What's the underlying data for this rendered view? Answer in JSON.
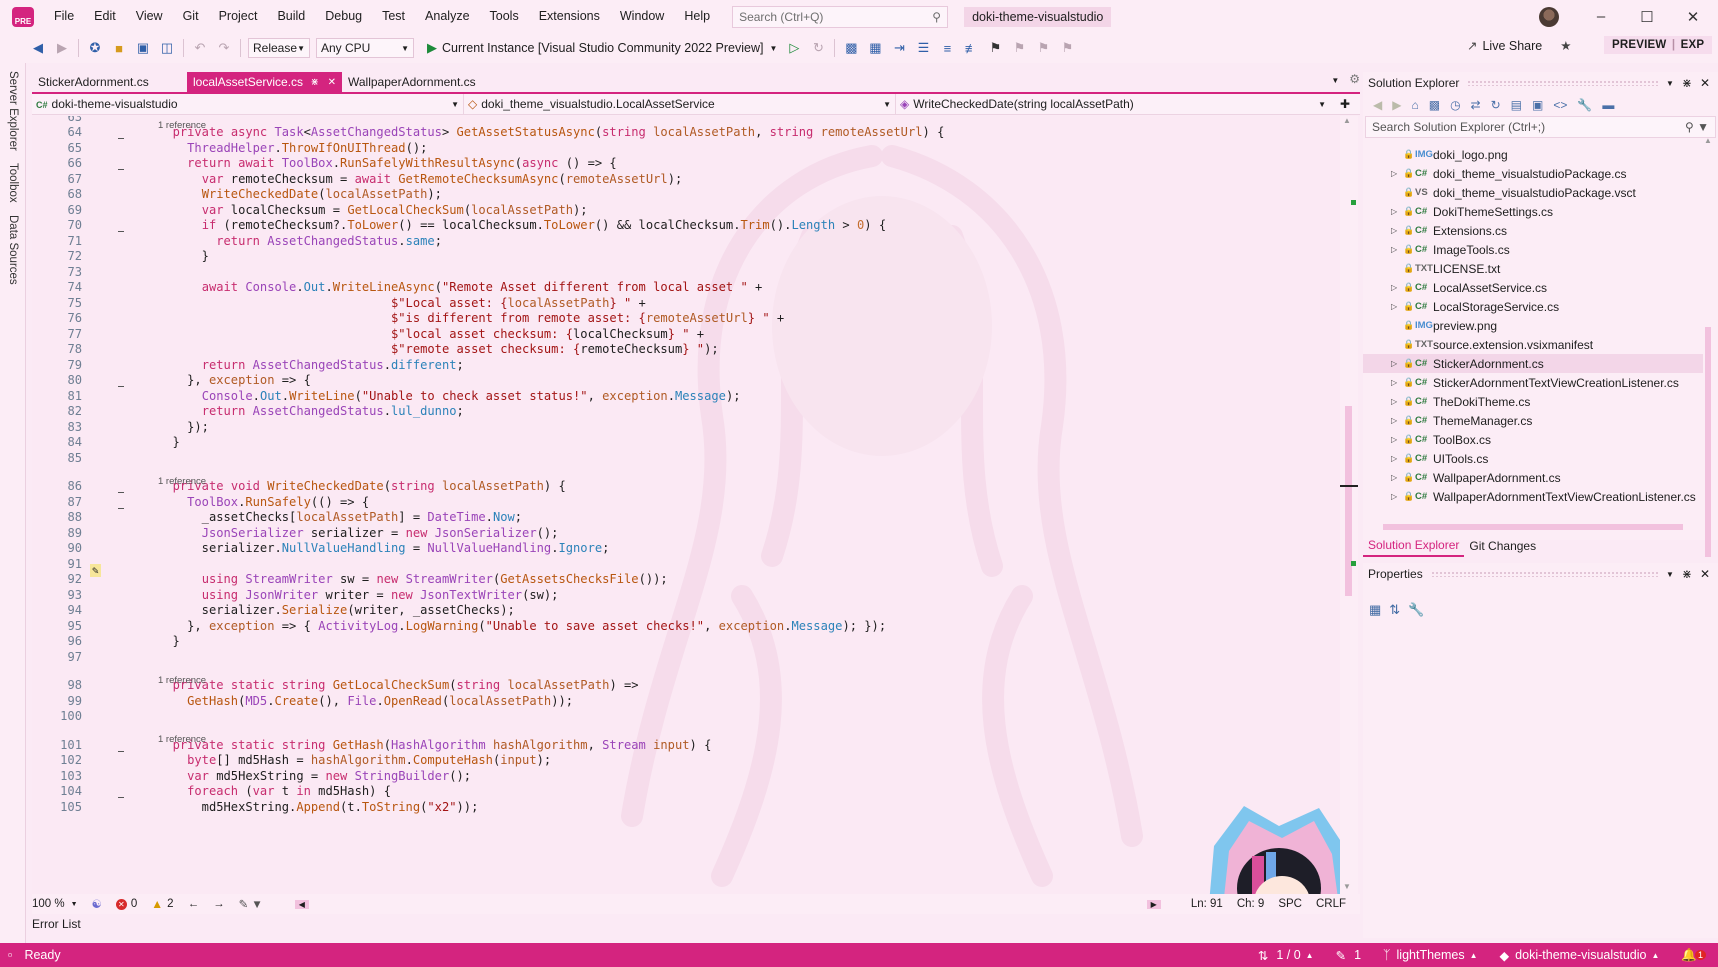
{
  "menu": [
    "File",
    "Edit",
    "View",
    "Git",
    "Project",
    "Build",
    "Debug",
    "Test",
    "Analyze",
    "Tools",
    "Extensions",
    "Window",
    "Help"
  ],
  "logo_text": "PRE",
  "search": {
    "placeholder": "Search (Ctrl+Q)"
  },
  "solution_name": "doki-theme-visualstudio",
  "toolbar": {
    "configuration": "Release",
    "platform": "Any CPU",
    "run_target": "Current Instance [Visual Studio Community 2022 Preview]",
    "live_share": "Live Share",
    "preview_badge": "PREVIEW",
    "exp_badge": "EXP"
  },
  "side_tabs": [
    "Server Explorer",
    "Toolbox",
    "Data Sources"
  ],
  "doc_tabs": [
    {
      "label": "StickerAdornment.cs",
      "active": false
    },
    {
      "label": "localAssetService.cs",
      "active": true
    },
    {
      "label": "WallpaperAdornment.cs",
      "active": false
    }
  ],
  "navbar": {
    "project": "doki-theme-visualstudio",
    "type": "doki_theme_visualstudio.LocalAssetService",
    "member": "WriteCheckedDate(string localAssetPath)"
  },
  "code": [
    {
      "n": "63",
      "ref": "1 reference",
      "h": ""
    },
    {
      "n": "64",
      "h": "  <k>private</k> <k>async</k> <t>Task</t>&lt;<t>AssetChangedStatus</t>&gt; <m>GetAssetStatusAsync</m>(<k>string</k> <p>localAssetPath</p>, <k>string</k> <p>remoteAssetUrl</p>) {"
    },
    {
      "n": "65",
      "h": "    <t>ThreadHelper</t>.<m>ThrowIfOnUIThread</m>();"
    },
    {
      "n": "66",
      "h": "    <k>return</k> <k>await</k> <t>ToolBox</t>.<m>RunSafelyWithResultAsync</m>(<k>async</k> () =&gt; {"
    },
    {
      "n": "67",
      "h": "      <k>var</k> remoteChecksum = <k>await</k> <m>GetRemoteChecksumAsync</m>(<p>remoteAssetUrl</p>);"
    },
    {
      "n": "68",
      "h": "      <m>WriteCheckedDate</m>(<p>localAssetPath</p>);"
    },
    {
      "n": "69",
      "h": "      <k>var</k> localChecksum = <m>GetLocalCheckSum</m>(<p>localAssetPath</p>);"
    },
    {
      "n": "70",
      "h": "      <k>if</k> (remoteChecksum?.<m>ToLower</m>() == localChecksum.<m>ToLower</m>() &amp;&amp; localChecksum.<m>Trim</m>().<f>Length</f> &gt; <n>0</n>) {"
    },
    {
      "n": "71",
      "h": "        <k>return</k> <t>AssetChangedStatus</t>.<f>same</f>;"
    },
    {
      "n": "72",
      "h": "      }"
    },
    {
      "n": "73",
      "h": ""
    },
    {
      "n": "74",
      "h": "      <k>await</k> <t>Console</t>.<f>Out</f>.<m>WriteLineAsync</m>(<s>\"Remote Asset different from local asset \"</s> +"
    },
    {
      "n": "75",
      "h": "                                <s>$\"Local asset: {</s><p>localAssetPath</p><s>} \"</s> +"
    },
    {
      "n": "76",
      "h": "                                <s>$\"is different from remote asset: {</s><p>remoteAssetUrl</p><s>} \"</s> +"
    },
    {
      "n": "77",
      "h": "                                <s>$\"local asset checksum: {</s>localChecksum<s>} \"</s> +"
    },
    {
      "n": "78",
      "h": "                                <s>$\"remote asset checksum: {</s>remoteChecksum<s>} \"</s>);"
    },
    {
      "n": "79",
      "h": "      <k>return</k> <t>AssetChangedStatus</t>.<f>different</f>;"
    },
    {
      "n": "80",
      "h": "    }, <p>exception</p> =&gt; {"
    },
    {
      "n": "81",
      "h": "      <t>Console</t>.<f>Out</f>.<m>WriteLine</m>(<s>\"Unable to check asset status!\"</s>, <p>exception</p>.<f>Message</f>);"
    },
    {
      "n": "82",
      "h": "      <k>return</k> <t>AssetChangedStatus</t>.<f>lul_dunno</f>;"
    },
    {
      "n": "83",
      "h": "    });"
    },
    {
      "n": "84",
      "h": "  }"
    },
    {
      "n": "85",
      "h": ""
    },
    {
      "n": "86",
      "ref": "1 reference",
      "h": "  <k>private</k> <k>void</k> <m>WriteCheckedDate</m>(<k>string</k> <p>localAssetPath</p>) {"
    },
    {
      "n": "87",
      "h": "    <t>ToolBox</t>.<m>RunSafely</m>(() =&gt; {"
    },
    {
      "n": "88",
      "h": "      _assetChecks[<p>localAssetPath</p>] = <t>DateTime</t>.<f>Now</f>;"
    },
    {
      "n": "89",
      "h": "      <t>JsonSerializer</t> serializer = <k>new</k> <t>JsonSerializer</t>();"
    },
    {
      "n": "90",
      "h": "      serializer.<f>NullValueHandling</f> = <t>NullValueHandling</t>.<f>Ignore</f>;"
    },
    {
      "n": "91",
      "h": ""
    },
    {
      "n": "92",
      "h": "      <k>using</k> <t>StreamWriter</t> sw = <k>new</k> <t>StreamWriter</t>(<m>GetAssetsChecksFile</m>());"
    },
    {
      "n": "93",
      "h": "      <k>using</k> <t>JsonWriter</t> writer = <k>new</k> <t>JsonTextWriter</t>(sw);"
    },
    {
      "n": "94",
      "h": "      serializer.<m>Serialize</m>(writer, _assetChecks);"
    },
    {
      "n": "95",
      "h": "    }, <p>exception</p> =&gt; { <t>ActivityLog</t>.<m>LogWarning</m>(<s>\"Unable to save asset checks!\"</s>, <p>exception</p>.<f>Message</f>); });"
    },
    {
      "n": "96",
      "h": "  }"
    },
    {
      "n": "97",
      "h": ""
    },
    {
      "n": "98",
      "ref": "1 reference",
      "h": "  <k>private</k> <k>static</k> <k>string</k> <m>GetLocalCheckSum</m>(<k>string</k> <p>localAssetPath</p>) =&gt;"
    },
    {
      "n": "99",
      "h": "    <m>GetHash</m>(<t>MD5</t>.<m>Create</m>(), <t>File</t>.<m>OpenRead</m>(<p>localAssetPath</p>));"
    },
    {
      "n": "100",
      "h": ""
    },
    {
      "n": "101",
      "ref": "1 reference",
      "h": "  <k>private</k> <k>static</k> <k>string</k> <m>GetHash</m>(<t>HashAlgorithm</t> <p>hashAlgorithm</p>, <t>Stream</t> <p>input</p>) {"
    },
    {
      "n": "102",
      "h": "    <k>byte</k>[] md5Hash = <p>hashAlgorithm</p>.<m>ComputeHash</m>(<p>input</p>);"
    },
    {
      "n": "103",
      "h": "    <k>var</k> md5HexString = <k>new</k> <t>StringBuilder</t>();"
    },
    {
      "n": "104",
      "h": "    <k>foreach</k> (<k>var</k> t <k>in</k> md5Hash) {"
    },
    {
      "n": "105",
      "h": "      md5HexString.<m>Append</m>(t.<m>ToString</m>(<s>\"x2\"</s>));"
    }
  ],
  "editor_status": {
    "zoom": "100 %",
    "errors": "0",
    "warnings": "2",
    "ln": "Ln: 91",
    "ch": "Ch: 9",
    "spc": "SPC",
    "crlf": "CRLF"
  },
  "error_list_label": "Error List",
  "status_bar": {
    "ready": "Ready",
    "sync": "1 / 0",
    "pencil": "1",
    "branch": "lightThemes",
    "repo": "doki-theme-visualstudio",
    "notifications": "1"
  },
  "solution_explorer": {
    "title": "Solution Explorer",
    "search_placeholder": "Search Solution Explorer (Ctrl+;)",
    "items": [
      {
        "label": "doki_logo.png",
        "icon": "IMG",
        "expandable": false
      },
      {
        "label": "doki_theme_visualstudioPackage.cs",
        "icon": "C#",
        "expandable": true
      },
      {
        "label": "doki_theme_visualstudioPackage.vsct",
        "icon": "VS",
        "expandable": false
      },
      {
        "label": "DokiThemeSettings.cs",
        "icon": "C#",
        "expandable": true
      },
      {
        "label": "Extensions.cs",
        "icon": "C#",
        "expandable": true
      },
      {
        "label": "ImageTools.cs",
        "icon": "C#",
        "expandable": true
      },
      {
        "label": "LICENSE.txt",
        "icon": "TXT",
        "expandable": false
      },
      {
        "label": "LocalAssetService.cs",
        "icon": "C#",
        "expandable": true
      },
      {
        "label": "LocalStorageService.cs",
        "icon": "C#",
        "expandable": true
      },
      {
        "label": "preview.png",
        "icon": "IMG",
        "expandable": false
      },
      {
        "label": "source.extension.vsixmanifest",
        "icon": "TXT",
        "expandable": false
      },
      {
        "label": "StickerAdornment.cs",
        "icon": "C#",
        "expandable": true,
        "selected": true
      },
      {
        "label": "StickerAdornmentTextViewCreationListener.cs",
        "icon": "C#",
        "expandable": true
      },
      {
        "label": "TheDokiTheme.cs",
        "icon": "C#",
        "expandable": true
      },
      {
        "label": "ThemeManager.cs",
        "icon": "C#",
        "expandable": true
      },
      {
        "label": "ToolBox.cs",
        "icon": "C#",
        "expandable": true
      },
      {
        "label": "UITools.cs",
        "icon": "C#",
        "expandable": true
      },
      {
        "label": "WallpaperAdornment.cs",
        "icon": "C#",
        "expandable": true
      },
      {
        "label": "WallpaperAdornmentTextViewCreationListener.cs",
        "icon": "C#",
        "expandable": true
      }
    ],
    "tabs": [
      "Solution Explorer",
      "Git Changes"
    ]
  },
  "properties": {
    "title": "Properties"
  },
  "colors": {
    "accent": "#d4247f",
    "background": "#fbe9f4",
    "keyword": "#c72c6e",
    "type": "#9a44b8",
    "method": "#b8560f",
    "string": "#a31515"
  }
}
